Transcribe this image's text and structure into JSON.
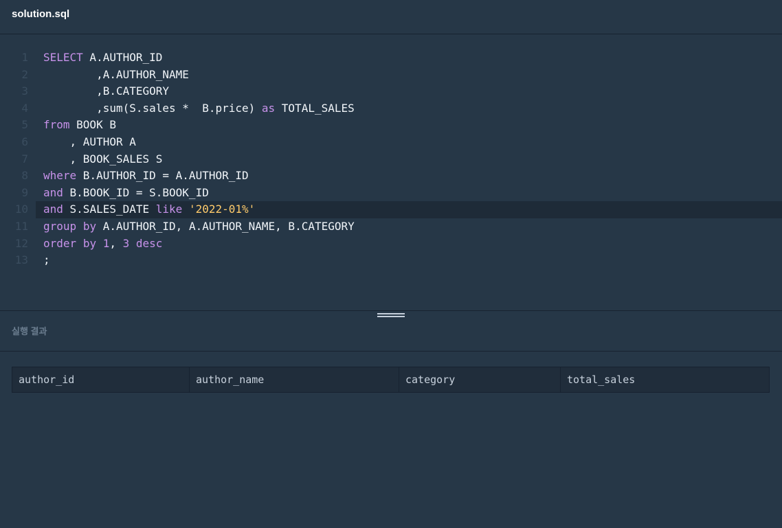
{
  "tab": {
    "title": "solution.sql"
  },
  "editor": {
    "lines": [
      {
        "num": "1",
        "tokens": [
          [
            "kw",
            "SELECT"
          ],
          [
            "txt",
            " A.AUTHOR_ID"
          ]
        ]
      },
      {
        "num": "2",
        "tokens": [
          [
            "txt",
            "        ,A.AUTHOR_NAME"
          ]
        ]
      },
      {
        "num": "3",
        "tokens": [
          [
            "txt",
            "        ,B.CATEGORY"
          ]
        ]
      },
      {
        "num": "4",
        "tokens": [
          [
            "txt",
            "        ,sum(S.sales *  B.price) "
          ],
          [
            "kw",
            "as"
          ],
          [
            "txt",
            " TOTAL_SALES"
          ]
        ]
      },
      {
        "num": "5",
        "tokens": [
          [
            "kw",
            "from"
          ],
          [
            "txt",
            " BOOK B"
          ]
        ]
      },
      {
        "num": "6",
        "tokens": [
          [
            "txt",
            "    , AUTHOR A"
          ]
        ]
      },
      {
        "num": "7",
        "tokens": [
          [
            "txt",
            "    , BOOK_SALES S"
          ]
        ]
      },
      {
        "num": "8",
        "tokens": [
          [
            "kw",
            "where"
          ],
          [
            "txt",
            " B.AUTHOR_ID = A.AUTHOR_ID"
          ]
        ]
      },
      {
        "num": "9",
        "tokens": [
          [
            "kw",
            "and"
          ],
          [
            "txt",
            " B.BOOK_ID = S.BOOK_ID"
          ]
        ]
      },
      {
        "num": "10",
        "tokens": [
          [
            "kw",
            "and"
          ],
          [
            "txt",
            " S.SALES_DATE "
          ],
          [
            "kw",
            "like"
          ],
          [
            "txt",
            " "
          ],
          [
            "str",
            "'2022-01%'"
          ]
        ],
        "active": true
      },
      {
        "num": "11",
        "tokens": [
          [
            "kw",
            "group"
          ],
          [
            "txt",
            " "
          ],
          [
            "kw",
            "by"
          ],
          [
            "txt",
            " A.AUTHOR_ID, A.AUTHOR_NAME, B.CATEGORY"
          ]
        ]
      },
      {
        "num": "12",
        "tokens": [
          [
            "kw",
            "order"
          ],
          [
            "txt",
            " "
          ],
          [
            "kw",
            "by"
          ],
          [
            "txt",
            " "
          ],
          [
            "num",
            "1"
          ],
          [
            "txt",
            ", "
          ],
          [
            "num",
            "3"
          ],
          [
            "txt",
            " "
          ],
          [
            "kw",
            "desc"
          ]
        ]
      },
      {
        "num": "13",
        "tokens": [
          [
            "txt",
            ";"
          ]
        ]
      }
    ]
  },
  "results": {
    "title": "실행 결과",
    "columns": [
      "author_id",
      "author_name",
      "category",
      "total_sales"
    ]
  },
  "colors": {
    "background": "#263747",
    "keyword": "#c792ea",
    "string": "#ffcb6b",
    "line_number": "#3a4d5f",
    "active_line": "#1e2b38"
  },
  "icons": {
    "resize_handle": "drag-handle-icon"
  }
}
